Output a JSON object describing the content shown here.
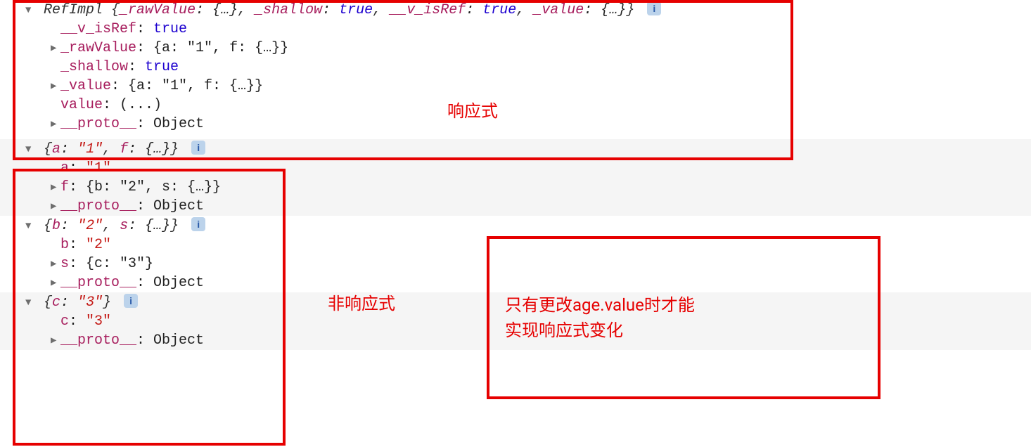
{
  "section1": {
    "header_pre": "RefImpl {",
    "header_parts": [
      {
        "k": "_rawValue",
        "v": "{…}",
        "t": "obj"
      },
      {
        "k": "_shallow",
        "v": "true",
        "t": "kw"
      },
      {
        "k": "__v_isRef",
        "v": "true",
        "t": "kw"
      },
      {
        "k": "_value",
        "v": "{…}",
        "t": "obj"
      }
    ],
    "header_post": "}",
    "rows": [
      {
        "tri": "",
        "k": "__v_isRef",
        "colon": ": ",
        "v": "true",
        "t": "kw"
      },
      {
        "tri": "▶",
        "k": "_rawValue",
        "colon": ": ",
        "v": "{a: \"1\", f: {…}}",
        "t": "obj"
      },
      {
        "tri": "",
        "k": "_shallow",
        "colon": ": ",
        "v": "true",
        "t": "kw"
      },
      {
        "tri": "▶",
        "k": "_value",
        "colon": ": ",
        "v": "{a: \"1\", f: {…}}",
        "t": "obj"
      },
      {
        "tri": "",
        "k": "value",
        "colon": ": ",
        "v": "(...)",
        "t": "obj"
      },
      {
        "tri": "▶",
        "k": "__proto__",
        "colon": ": ",
        "v": "Object",
        "t": "obj"
      }
    ]
  },
  "section2": {
    "header_parts": [
      {
        "k": "a",
        "v": "\"1\"",
        "t": "str"
      },
      {
        "k": "f",
        "v": "{…}",
        "t": "obj"
      }
    ],
    "rows": [
      {
        "tri": "",
        "k": "a",
        "colon": ": ",
        "v": "\"1\"",
        "t": "str"
      },
      {
        "tri": "▶",
        "k": "f",
        "colon": ": ",
        "v": "{b: \"2\", s: {…}}",
        "t": "obj"
      },
      {
        "tri": "▶",
        "k": "__proto__",
        "colon": ": ",
        "v": "Object",
        "t": "obj"
      }
    ]
  },
  "section3": {
    "header_parts": [
      {
        "k": "b",
        "v": "\"2\"",
        "t": "str"
      },
      {
        "k": "s",
        "v": "{…}",
        "t": "obj"
      }
    ],
    "rows": [
      {
        "tri": "",
        "k": "b",
        "colon": ": ",
        "v": "\"2\"",
        "t": "str"
      },
      {
        "tri": "▶",
        "k": "s",
        "colon": ": ",
        "v": "{c: \"3\"}",
        "t": "obj"
      },
      {
        "tri": "▶",
        "k": "__proto__",
        "colon": ": ",
        "v": "Object",
        "t": "obj"
      }
    ]
  },
  "section4": {
    "header_parts": [
      {
        "k": "c",
        "v": "\"3\"",
        "t": "str"
      }
    ],
    "rows": [
      {
        "tri": "",
        "k": "c",
        "colon": ": ",
        "v": "\"3\"",
        "t": "str"
      },
      {
        "tri": "▶",
        "k": "__proto__",
        "colon": ": ",
        "v": "Object",
        "t": "obj"
      }
    ]
  },
  "annotations": {
    "right1": "响应式",
    "left2": "非响应式",
    "box3_line1": "只有更改age.value时才能",
    "box3_line2": "实现响应式变化"
  },
  "glyph_down": "▼",
  "glyph_right": "▶",
  "brace_open": "{",
  "brace_close": "}"
}
